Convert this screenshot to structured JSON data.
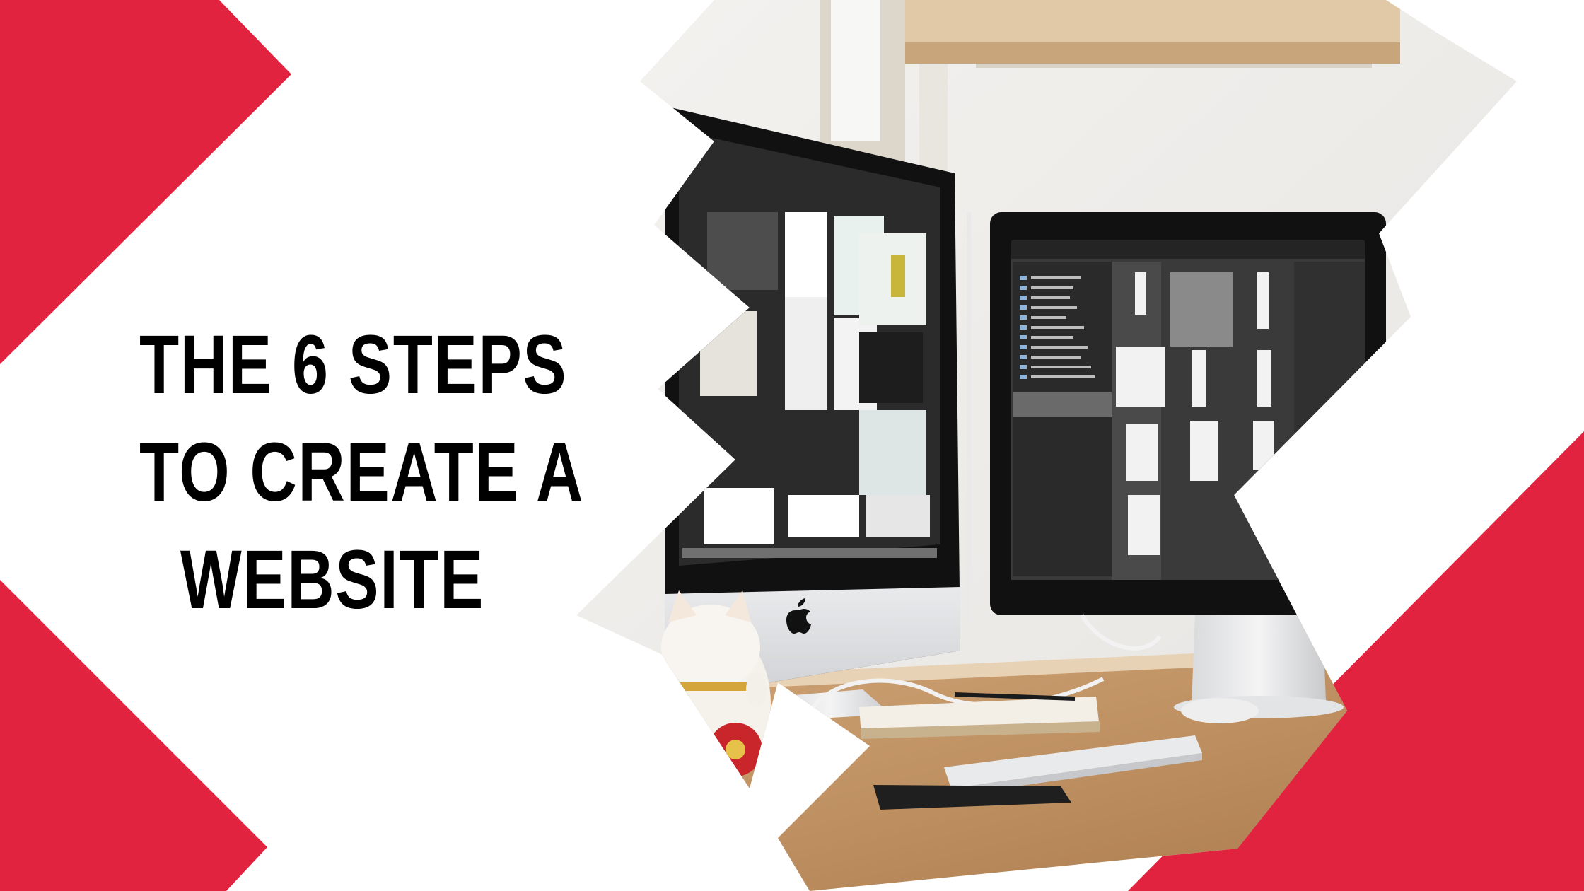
{
  "headline": {
    "line1": "THE 6 STEPS",
    "line2": "TO CREATE A",
    "line3": "WEBSITE"
  },
  "colors": {
    "accent_red": "#e2233f",
    "background": "#ffffff",
    "text": "#000000"
  },
  "photo": {
    "subject": "two desktop computer monitors on a wooden desk with keyboard, notebook and lucky cat figurine",
    "icons": [
      "apple-logo-icon",
      "apple-logo-icon"
    ]
  }
}
